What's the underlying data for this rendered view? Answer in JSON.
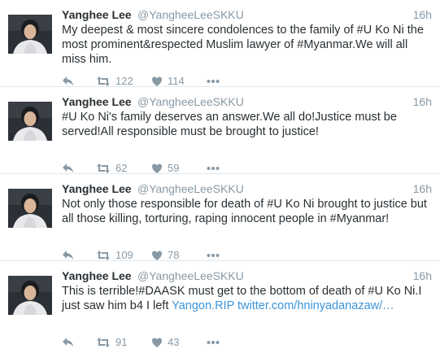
{
  "tweets": [
    {
      "fullname": "Yanghee Lee",
      "handle": "@YangheeLeeSKKU",
      "time": "16h",
      "text": "My deepest & most sincere condolences to the family of #U Ko Ni the most prominent&respected Muslim lawyer of #Myanmar.We will all miss him.",
      "link_text": "",
      "retweets": "122",
      "likes": "114"
    },
    {
      "fullname": "Yanghee Lee",
      "handle": "@YangheeLeeSKKU",
      "time": "16h",
      "text": "#U Ko Ni's family deserves an answer.We all do!Justice must be served!All responsible must be brought to justice!",
      "link_text": "",
      "retweets": "62",
      "likes": "59"
    },
    {
      "fullname": "Yanghee Lee",
      "handle": "@YangheeLeeSKKU",
      "time": "16h",
      "text": "Not only those responsible for death of #U Ko Ni brought to justice but all those killing, torturing, raping innocent people in #Myanmar!",
      "link_text": "",
      "retweets": "109",
      "likes": "78"
    },
    {
      "fullname": "Yanghee Lee",
      "handle": "@YangheeLeeSKKU",
      "time": "16h",
      "text": "This is terrible!#DAASK must get to the bottom of death of #U Ko Ni.I just saw him b4 I left ",
      "link_text": "Yangon.RIP twitter.com/hninyadanazaw/…",
      "retweets": "91",
      "likes": "43"
    }
  ],
  "icons": {
    "reply": "reply-icon",
    "retweet": "retweet-icon",
    "like": "heart-icon",
    "more": "more-dots-icon"
  },
  "colors": {
    "text": "#292f33",
    "muted": "#8899a6",
    "link": "#3b94d9",
    "divider": "#e1e8ed"
  }
}
